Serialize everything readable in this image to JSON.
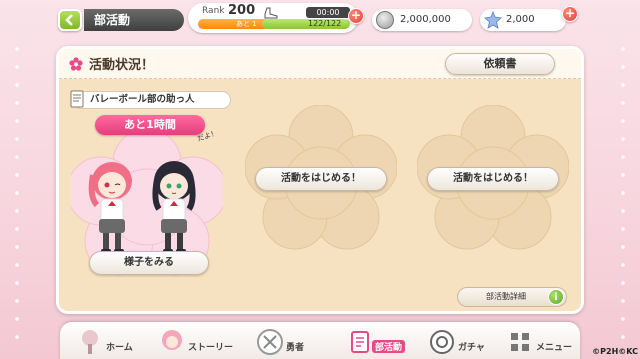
{
  "header": {
    "title": "部活動",
    "rank_label": "Rank",
    "rank_value": "200",
    "rank_remaining": "あと 1",
    "rank_progress": 0.97,
    "stamina_timer": "00:00",
    "stamina": "122/122",
    "stamina_progress": 1.0,
    "coins": "2,000,000",
    "gems": "2,000"
  },
  "panel": {
    "title": "活動状況！",
    "request_button": "依頼書",
    "slot1": {
      "job_title": "バレーボール部の助っ人",
      "time_remaining": "あと1時間",
      "speech": "だよ！",
      "watch_button": "様子をみる"
    },
    "slot2": {
      "start_button": "活動をはじめる！"
    },
    "slot3": {
      "start_button": "活動をはじめる！"
    },
    "detail_button": "部活動詳細"
  },
  "nav": {
    "items": [
      {
        "label": "ホーム"
      },
      {
        "label": "ストーリー"
      },
      {
        "label": "勇者"
      },
      {
        "label": "部活動"
      },
      {
        "label": "ガチャ"
      },
      {
        "label": "メニュー"
      }
    ],
    "active": "部活動"
  },
  "copyright": "©P2H©KC",
  "colors": {
    "accent_pink": "#e64a87",
    "panel_bg": "#f6e1c0",
    "plus_red": "#e8413a",
    "green": "#7fb72a"
  }
}
